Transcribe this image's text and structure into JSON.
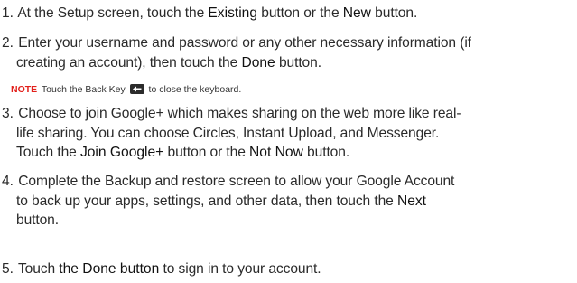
{
  "steps": [
    {
      "number": "1.",
      "parts": [
        "At the Setup screen, touch the ",
        "Existing",
        " button or the ",
        "New",
        " button."
      ]
    },
    {
      "number": "2.",
      "line1": "Enter your username and password or any other necessary information (if",
      "line2a": "creating an account), then touch the ",
      "line2b": "Done",
      "line2c": " button."
    },
    {
      "number": "3.",
      "line1": "Choose to join Google+ which makes sharing on the web more like real-",
      "line2": "life sharing.  You can choose Circles, Instant Upload, and Messenger.",
      "line3a": "Touch the ",
      "line3b": "Join Google+",
      "line3c": " button or the ",
      "line3d": "Not Now",
      "line3e": " button."
    },
    {
      "number": "4.",
      "line1": "Complete the Backup and restore screen to allow your Google Account",
      "line2a": "to back up your apps, settings, and other data, then touch the ",
      "line2b": "Next",
      "line3": "button."
    },
    {
      "number": "5.",
      "parts": [
        "Touch ",
        "the Done button",
        " to sign in to your account."
      ]
    }
  ],
  "note": {
    "label": "NOTE",
    "text_before": "Touch the ",
    "key_name": "Back Key",
    "text_after": " to close the keyboard.",
    "icon": "back-key-icon"
  }
}
